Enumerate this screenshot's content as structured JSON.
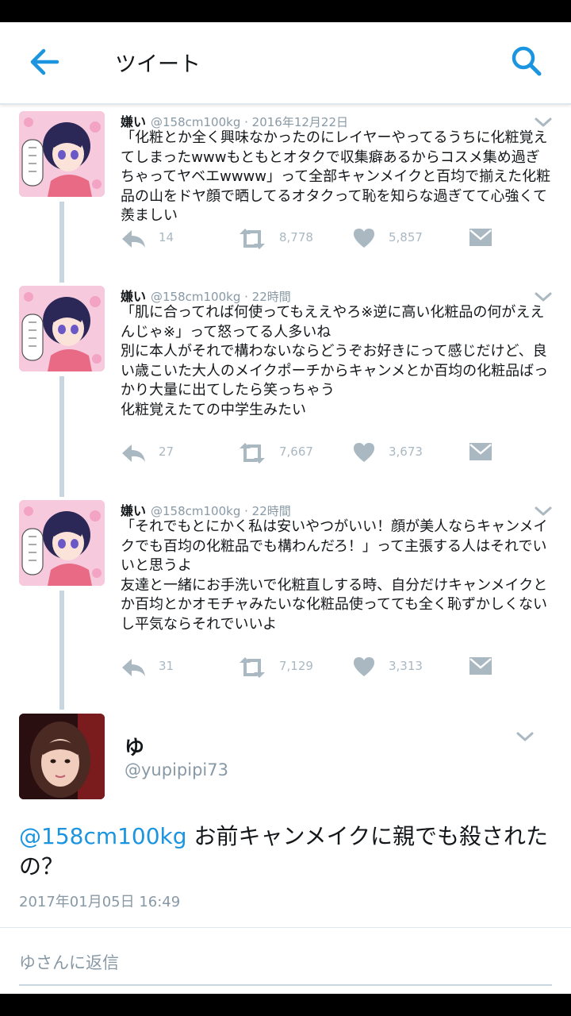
{
  "header": {
    "title": "ツイート"
  },
  "thread": [
    {
      "name": "嫌い",
      "handle": "@158cm100kg",
      "time": "2016年12月22日",
      "text": "「化粧とか全く興味なかったのにレイヤーやってるうちに化粧覚えてしまったwwwもともとオタクで収集癖あるからコスメ集め過ぎちゃってヤベエwwww」って全部キャンメイクと百均で揃えた化粧品の山をドヤ顔で晒してるオタクって恥を知らな過ぎてて心強くて羨ましい",
      "replies": "14",
      "retweets": "8,778",
      "likes": "5,857"
    },
    {
      "name": "嫌い",
      "handle": "@158cm100kg",
      "time": "22時間",
      "text": "「肌に合ってれば何使ってもええやろ※逆に高い化粧品の何がええんじゃ※」って怒ってる人多いね\n別に本人がそれで構わないならどうぞお好きにって感じだけど、良い歳こいた大人のメイクポーチからキャンメとか百均の化粧品ばっかり大量に出てしたら笑っちゃう\n化粧覚えたての中学生みたい",
      "replies": "27",
      "retweets": "7,667",
      "likes": "3,673"
    },
    {
      "name": "嫌い",
      "handle": "@158cm100kg",
      "time": "22時間",
      "text": "「それでもとにかく私は安いやつがいい！顔が美人ならキャンメイクでも百均の化粧品でも構わんだろ！」って主張する人はそれでいいと思うよ\n友達と一緒にお手洗いで化粧直しする時、自分だけキャンメイクとか百均とかオモチャみたいな化粧品使ってても全く恥ずかしくないし平気ならそれでいいよ",
      "replies": "31",
      "retweets": "7,129",
      "likes": "3,313"
    }
  ],
  "main_tweet": {
    "name": "ゆ",
    "handle": "@yupipipi73",
    "mention": "@158cm100kg",
    "text": " お前キャンメイクに親でも殺されたの？",
    "timestamp": "2017年01月05日 16:49"
  },
  "reply": {
    "placeholder": "ゆさんに返信"
  },
  "colors": {
    "accent": "#1b95e0",
    "text": "#14171a",
    "muted": "#8899a6",
    "action_icon": "#aab8c2",
    "thread_line": "#c8d6df"
  },
  "icons": [
    "back-arrow-icon",
    "search-icon",
    "reply-icon",
    "retweet-icon",
    "like-heart-icon",
    "direct-message-icon",
    "chevron-down-icon"
  ]
}
